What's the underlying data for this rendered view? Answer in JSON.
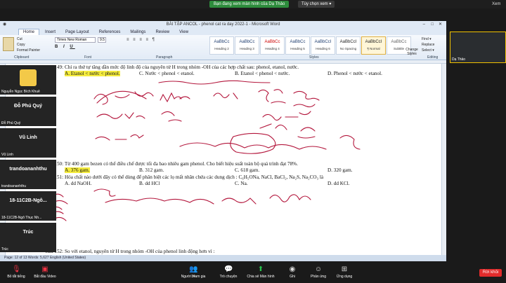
{
  "zoom": {
    "share_banner": "Bạn đang xem màn hình của Dạ Thảo",
    "view_options": "Tùy chọn xem ▾",
    "view_button": "Xem",
    "leave": "Rời khỏi",
    "bar": [
      {
        "icon": "mic-off-icon",
        "label": "Bỏ tắt tiếng"
      },
      {
        "icon": "camera-off-icon",
        "label": "Bắt đầu Video"
      },
      {
        "icon": "participants-icon",
        "label": "Người tham gia",
        "count": "14"
      },
      {
        "icon": "chat-icon",
        "label": "Trò chuyện"
      },
      {
        "icon": "share-screen-icon",
        "label": "Chia sẻ Màn hình"
      },
      {
        "icon": "record-icon",
        "label": "Ghi"
      },
      {
        "icon": "reactions-icon",
        "label": "Phản ứng"
      },
      {
        "icon": "apps-icon",
        "label": "Ứng dụng"
      }
    ]
  },
  "participants": [
    {
      "name": "Dạ Thảo",
      "big": ""
    },
    {
      "name": "Nguyễn Ngọc Bích Khuê",
      "big": ""
    },
    {
      "name": "Đỗ Phú Quý",
      "big": "Đỗ Phú Quý"
    },
    {
      "name": "Vũ Linh",
      "big": "Vũ Linh"
    },
    {
      "name": "trandoananhthu",
      "big": "trandoananhthu"
    },
    {
      "name": "18-11C2B-Ngô Thục Nh...",
      "big": "18-11C2B-Ngô..."
    },
    {
      "name": "Trúc",
      "big": "Trúc"
    }
  ],
  "word": {
    "title": "BÀI TẬP ANCOL - phenol cat ra day 2022-1 - Microsoft Word",
    "tabs": [
      "Home",
      "Insert",
      "Page Layout",
      "References",
      "Mailings",
      "Review",
      "View"
    ],
    "active_tab": "Home",
    "clipboard": {
      "paste": "Paste",
      "cut": "Cut",
      "copy": "Copy",
      "painter": "Format Painter",
      "group": "Clipboard"
    },
    "font": {
      "name": "Times New Roman",
      "size": "9.5",
      "bold": "B",
      "italic": "I",
      "underline": "U",
      "group": "Font"
    },
    "paragraph_group": "Paragraph",
    "styles_group": "Styles",
    "styles": [
      {
        "sample": "AaBbCc",
        "name": "Heading 2"
      },
      {
        "sample": "AaBbCc",
        "name": "Heading 3"
      },
      {
        "sample": "AaBbCc",
        "name": "Heading 4"
      },
      {
        "sample": "AaBbCc",
        "name": "Heading 5"
      },
      {
        "sample": "AaBbCcI",
        "name": "Heading 6"
      },
      {
        "sample": "AaBbCcI",
        "name": "No Spacing"
      },
      {
        "sample": "AaBbCcI",
        "name": "¶ Normal"
      },
      {
        "sample": "AaBbCc",
        "name": "Subtitle"
      }
    ],
    "change_styles": "Change Styles",
    "editing": {
      "find": "Find ▾",
      "replace": "Replace",
      "select": "Select ▾",
      "group": "Editing"
    },
    "status": "Page: 12 of 13   Words: 5,627   English (United States)",
    "doc": {
      "q149": "Câu 149: Chỉ ra thứ tự tăng dần mức độ linh độ của nguyên tử H trong nhóm -OH của các hợp chất sau: phenol, etanol, nước.",
      "q149_a": "A. Etanol < nước < phenol.",
      "q149_c": "C. Nước < phenol < etanol.",
      "q149_b": "B. Etanol < phenol < nước.",
      "q149_d": "D. Phenol < nước < etanol.",
      "q150": "Câu 150: Từ 400 gam bezen có thể điều chế được tối đa bao nhiêu gam phenol. Cho biết hiệu suất toàn bộ quá trình đạt 78%.",
      "q150_a": "A. 376 gam.",
      "q150_b": "B. 312 gam.",
      "q150_c": "C. 618 gam.",
      "q150_d": "D. 320 gam.",
      "q151": "Câu 151: Hóa chất nào dưới đây có thể dùng để phân biệt các lọ mất nhãn chứa các dung dịch : C₆H₅ONa, NaCl, BaCl₂, Na₂S, Na₂CO₃ là",
      "q151_a": "A. dd NaOH.",
      "q151_b": "B. dd HCl",
      "q151_c": "C. Na.",
      "q151_d": "D. dd KCl.",
      "q152": "Câu 152: So với etanol, nguyên tử H trong nhóm -OH của phenol linh động hơn vì :"
    }
  }
}
